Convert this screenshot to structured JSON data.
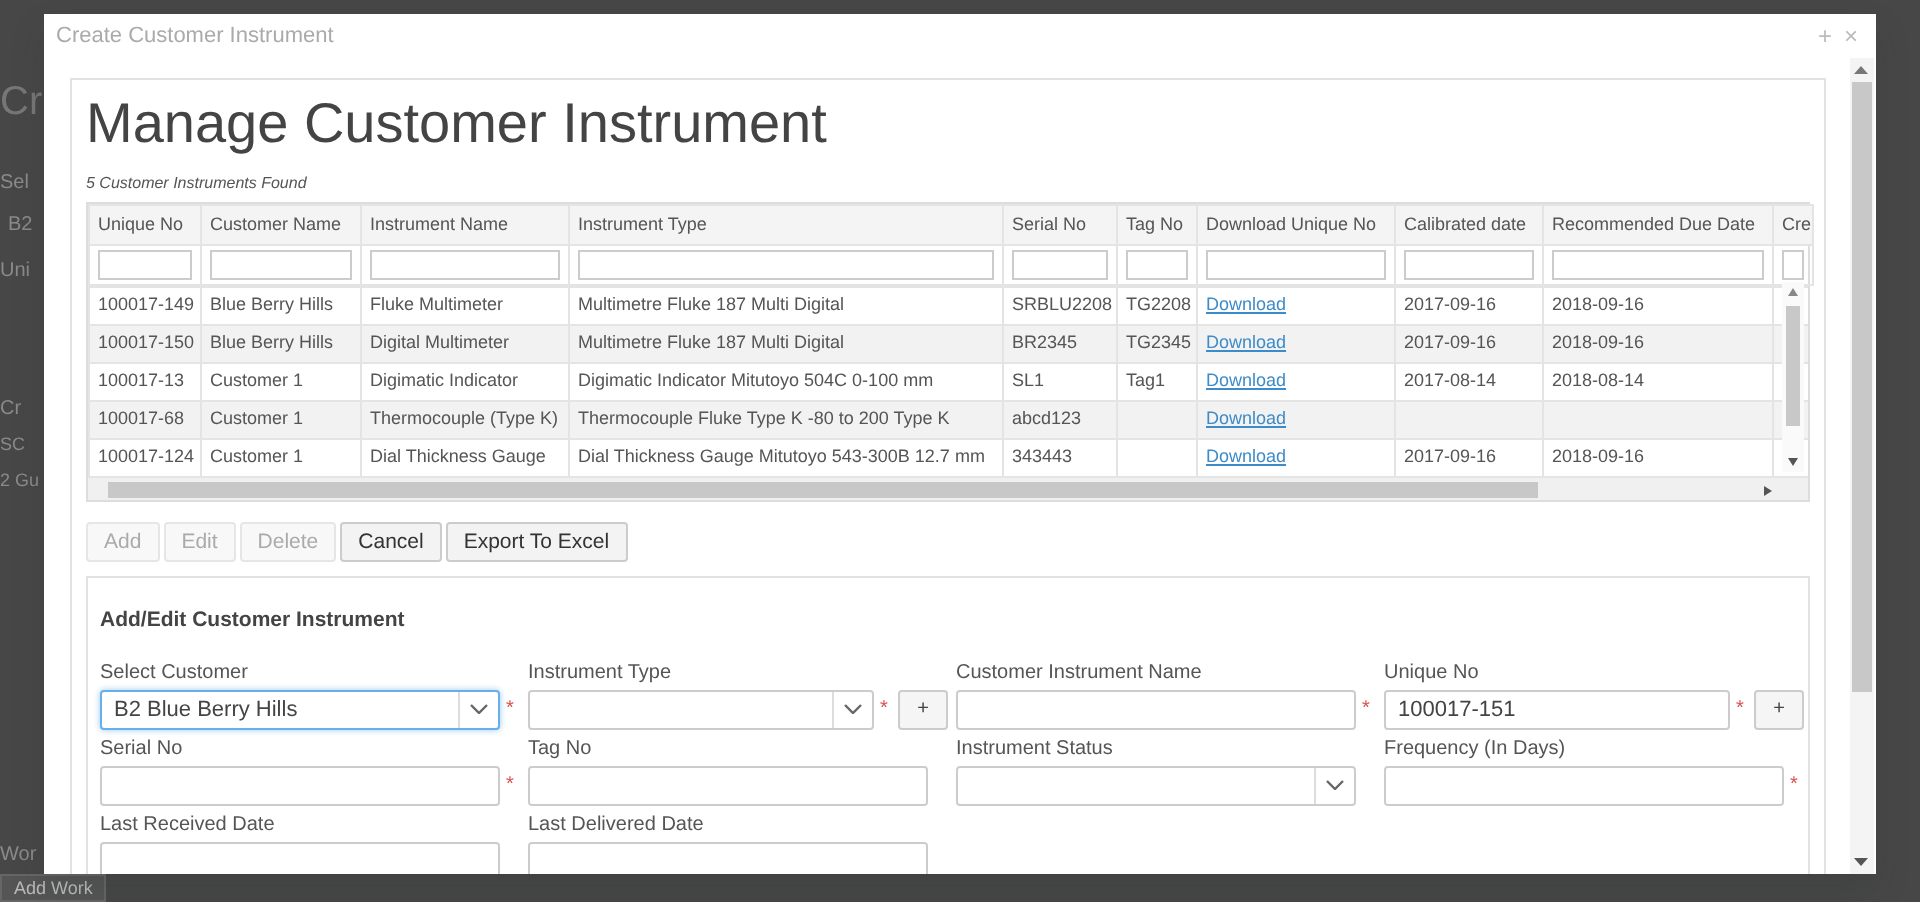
{
  "background_page": {
    "items": [
      {
        "kind": "heading",
        "text": "Cr"
      },
      {
        "kind": "label",
        "text": "Sel"
      },
      {
        "kind": "field",
        "text": "B2"
      },
      {
        "kind": "label",
        "text": "Uni"
      },
      {
        "kind": "chip",
        "text": "Cr"
      },
      {
        "kind": "text",
        "text": "SC"
      },
      {
        "kind": "text",
        "text": "2 Gu"
      },
      {
        "kind": "label",
        "text": "Wor"
      },
      {
        "kind": "button",
        "text": "Add Work"
      }
    ]
  },
  "dialog": {
    "title": "Create Customer Instrument",
    "maximize": "+",
    "close": "×"
  },
  "heading": "Manage Customer Instrument",
  "count_text": "5 Customer Instruments Found",
  "table": {
    "columns": [
      "Unique No",
      "Customer Name",
      "Instrument Name",
      "Instrument Type",
      "Serial No",
      "Tag No",
      "Download Unique No",
      "Calibrated date",
      "Recommended Due Date",
      "Cre"
    ],
    "rows": [
      [
        "100017-149",
        "Blue Berry Hills",
        "Fluke Multimeter",
        "Multimetre Fluke 187 Multi Digital",
        "SRBLU2208",
        "TG2208",
        "Download",
        "2017-09-16",
        "2018-09-16"
      ],
      [
        "100017-150",
        "Blue Berry Hills",
        "Digital Multimeter",
        "Multimetre Fluke 187 Multi Digital",
        "BR2345",
        "TG2345",
        "Download",
        "2017-09-16",
        "2018-09-16"
      ],
      [
        "100017-13",
        "Customer 1",
        "Digimatic Indicator",
        "Digimatic Indicator Mitutoyo 504C 0-100 mm",
        "SL1",
        "Tag1",
        "Download",
        "2017-08-14",
        "2018-08-14"
      ],
      [
        "100017-68",
        "Customer 1",
        "Thermocouple (Type K)",
        "Thermocouple Fluke Type K -80 to 200 Type K",
        "abcd123",
        "",
        "Download",
        "",
        ""
      ],
      [
        "100017-124",
        "Customer 1",
        "Dial Thickness Gauge",
        "Dial Thickness Gauge Mitutoyo 543-300B 12.7 mm",
        "343443",
        "",
        "Download",
        "2017-09-16",
        "2018-09-16"
      ]
    ]
  },
  "buttons": [
    {
      "label": "Add",
      "disabled": true
    },
    {
      "label": "Edit",
      "disabled": true
    },
    {
      "label": "Delete",
      "disabled": true
    },
    {
      "label": "Cancel",
      "disabled": false
    },
    {
      "label": "Export To Excel",
      "disabled": false
    }
  ],
  "form": {
    "title": "Add/Edit Customer Instrument",
    "fields": [
      {
        "label": "Select Customer",
        "kind": "select",
        "value": "B2 Blue Berry Hills",
        "required_mark": "*",
        "focused": true
      },
      {
        "label": "Instrument Type",
        "kind": "select",
        "required_mark": "*",
        "add_button": "+",
        "focused": false
      },
      {
        "label": "Customer Instrument Name",
        "kind": "text",
        "required_mark": "*",
        "focused": false
      },
      {
        "label": "Unique No",
        "kind": "text",
        "value": "100017-151",
        "required_mark": "*",
        "add_button": "+",
        "focused": false
      },
      {
        "label": "Serial No",
        "kind": "text",
        "required_mark": "*",
        "focused": false
      },
      {
        "label": "Tag No",
        "kind": "text",
        "focused": false
      },
      {
        "label": "Instrument Status",
        "kind": "select",
        "focused": false
      },
      {
        "label": "Frequency (In Days)",
        "kind": "text",
        "required_mark": "*",
        "focused": false
      },
      {
        "label": "Last Received Date",
        "kind": "text",
        "focused": false
      },
      {
        "label": "Last Delivered Date",
        "kind": "text",
        "focused": false
      }
    ]
  }
}
